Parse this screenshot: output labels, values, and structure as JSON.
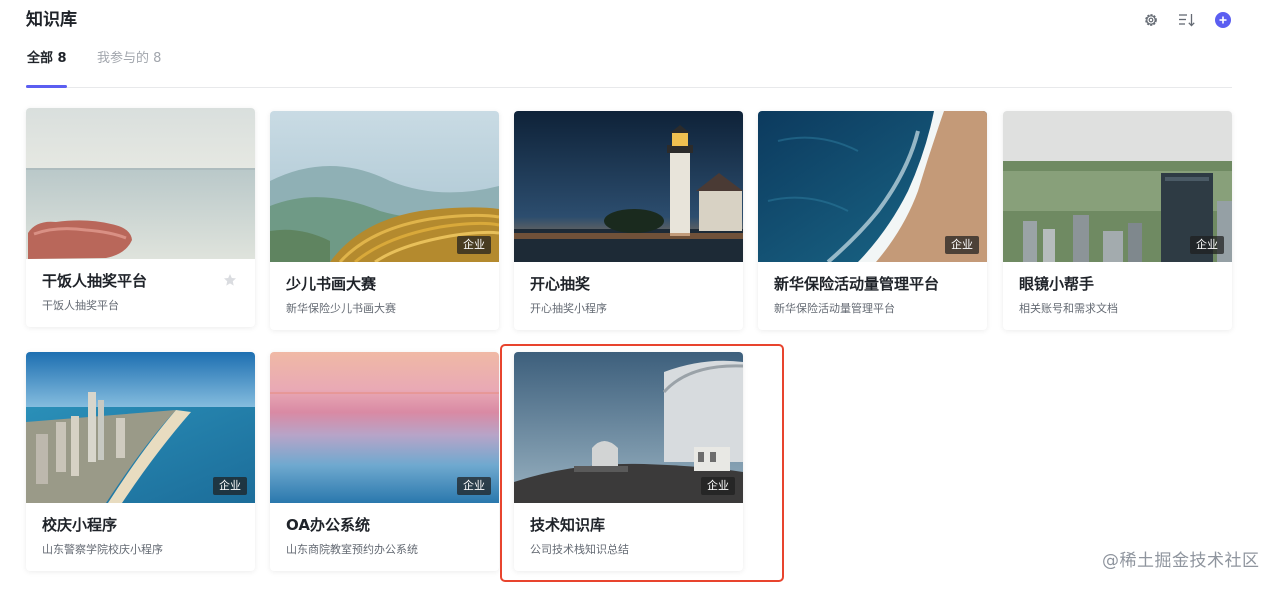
{
  "header": {
    "title": "知识库",
    "actions": [
      "gear-icon",
      "sort-icon",
      "plus-circle-icon"
    ]
  },
  "tabs": [
    {
      "label": "全部 8",
      "active": true
    },
    {
      "label": "我参与的 8",
      "active": false
    }
  ],
  "cards": [
    {
      "name": "干饭人抽奖平台",
      "desc": "干饭人抽奖平台",
      "badge": "",
      "starred": true,
      "cover": "beach-rock"
    },
    {
      "name": "少儿书画大赛",
      "desc": "新华保险少儿书画大赛",
      "badge": "企业",
      "cover": "rice-terraces"
    },
    {
      "name": "开心抽奖",
      "desc": "开心抽奖小程序",
      "badge": "",
      "cover": "lighthouse-night"
    },
    {
      "name": "新华保险活动量管理平台",
      "desc": "新华保险活动量管理平台",
      "badge": "企业",
      "cover": "ocean-shore"
    },
    {
      "name": "眼镜小帮手",
      "desc": "相关账号和需求文档",
      "badge": "企业",
      "cover": "city-park"
    },
    {
      "name": "校庆小程序",
      "desc": "山东警察学院校庆小程序",
      "badge": "企业",
      "cover": "coastal-city"
    },
    {
      "name": "OA办公系统",
      "desc": "山东商院教室预约办公系统",
      "badge": "企业",
      "cover": "pastel-sea"
    },
    {
      "name": "技术知识库",
      "desc": "公司技术栈知识总结",
      "badge": "企业",
      "cover": "observatory"
    }
  ],
  "watermark": "@稀土掘金技术社区",
  "colors": {
    "accent": "#5b5ef1",
    "highlight": "#e8442e",
    "badge_bg": "#1e1e1e"
  }
}
